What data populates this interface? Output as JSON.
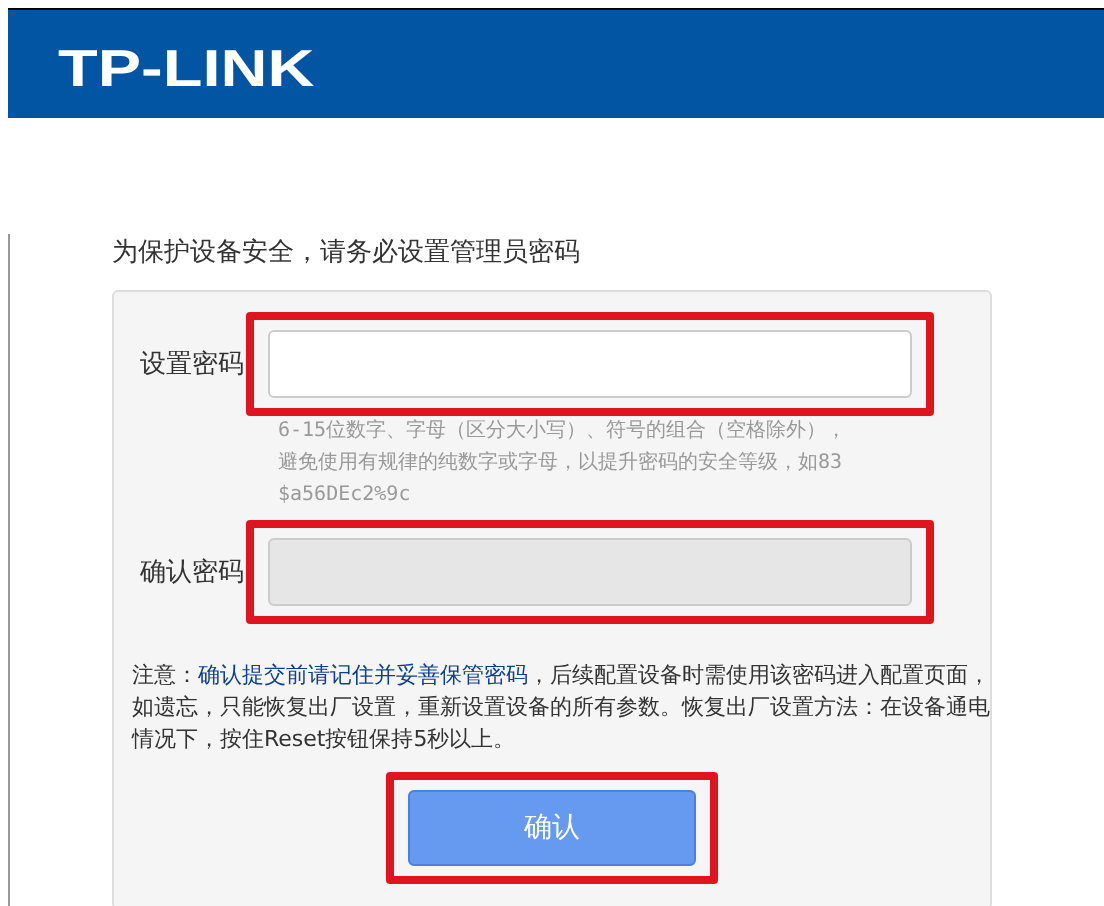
{
  "header": {
    "logo": "TP-LINK"
  },
  "prompt": "为保护设备安全，请务必设置管理员密码",
  "fields": [
    {
      "label": "设置密码",
      "disabled": false,
      "highlighted": true,
      "hint": [
        "6-15位数字、字母（区分大小写）、符号的组合（空格除外），",
        "避免使用有规律的纯数字或字母，以提升密码的安全等级，如83",
        "$a56DEc2%9c"
      ]
    },
    {
      "label": "确认密码",
      "disabled": true,
      "highlighted": true
    }
  ],
  "note": "注意：**确认提交前请记住并妥善保管密码**，后续配置设备时需使用该密码进入配置页面，如遗忘，只能恢复出厂设置，重新设置设备的所有参数。恢复出厂设置方法：在设备通电情况下，按住Reset按钮保持5秒以上。",
  "submit": {
    "label": "确认",
    "highlighted": true
  }
}
